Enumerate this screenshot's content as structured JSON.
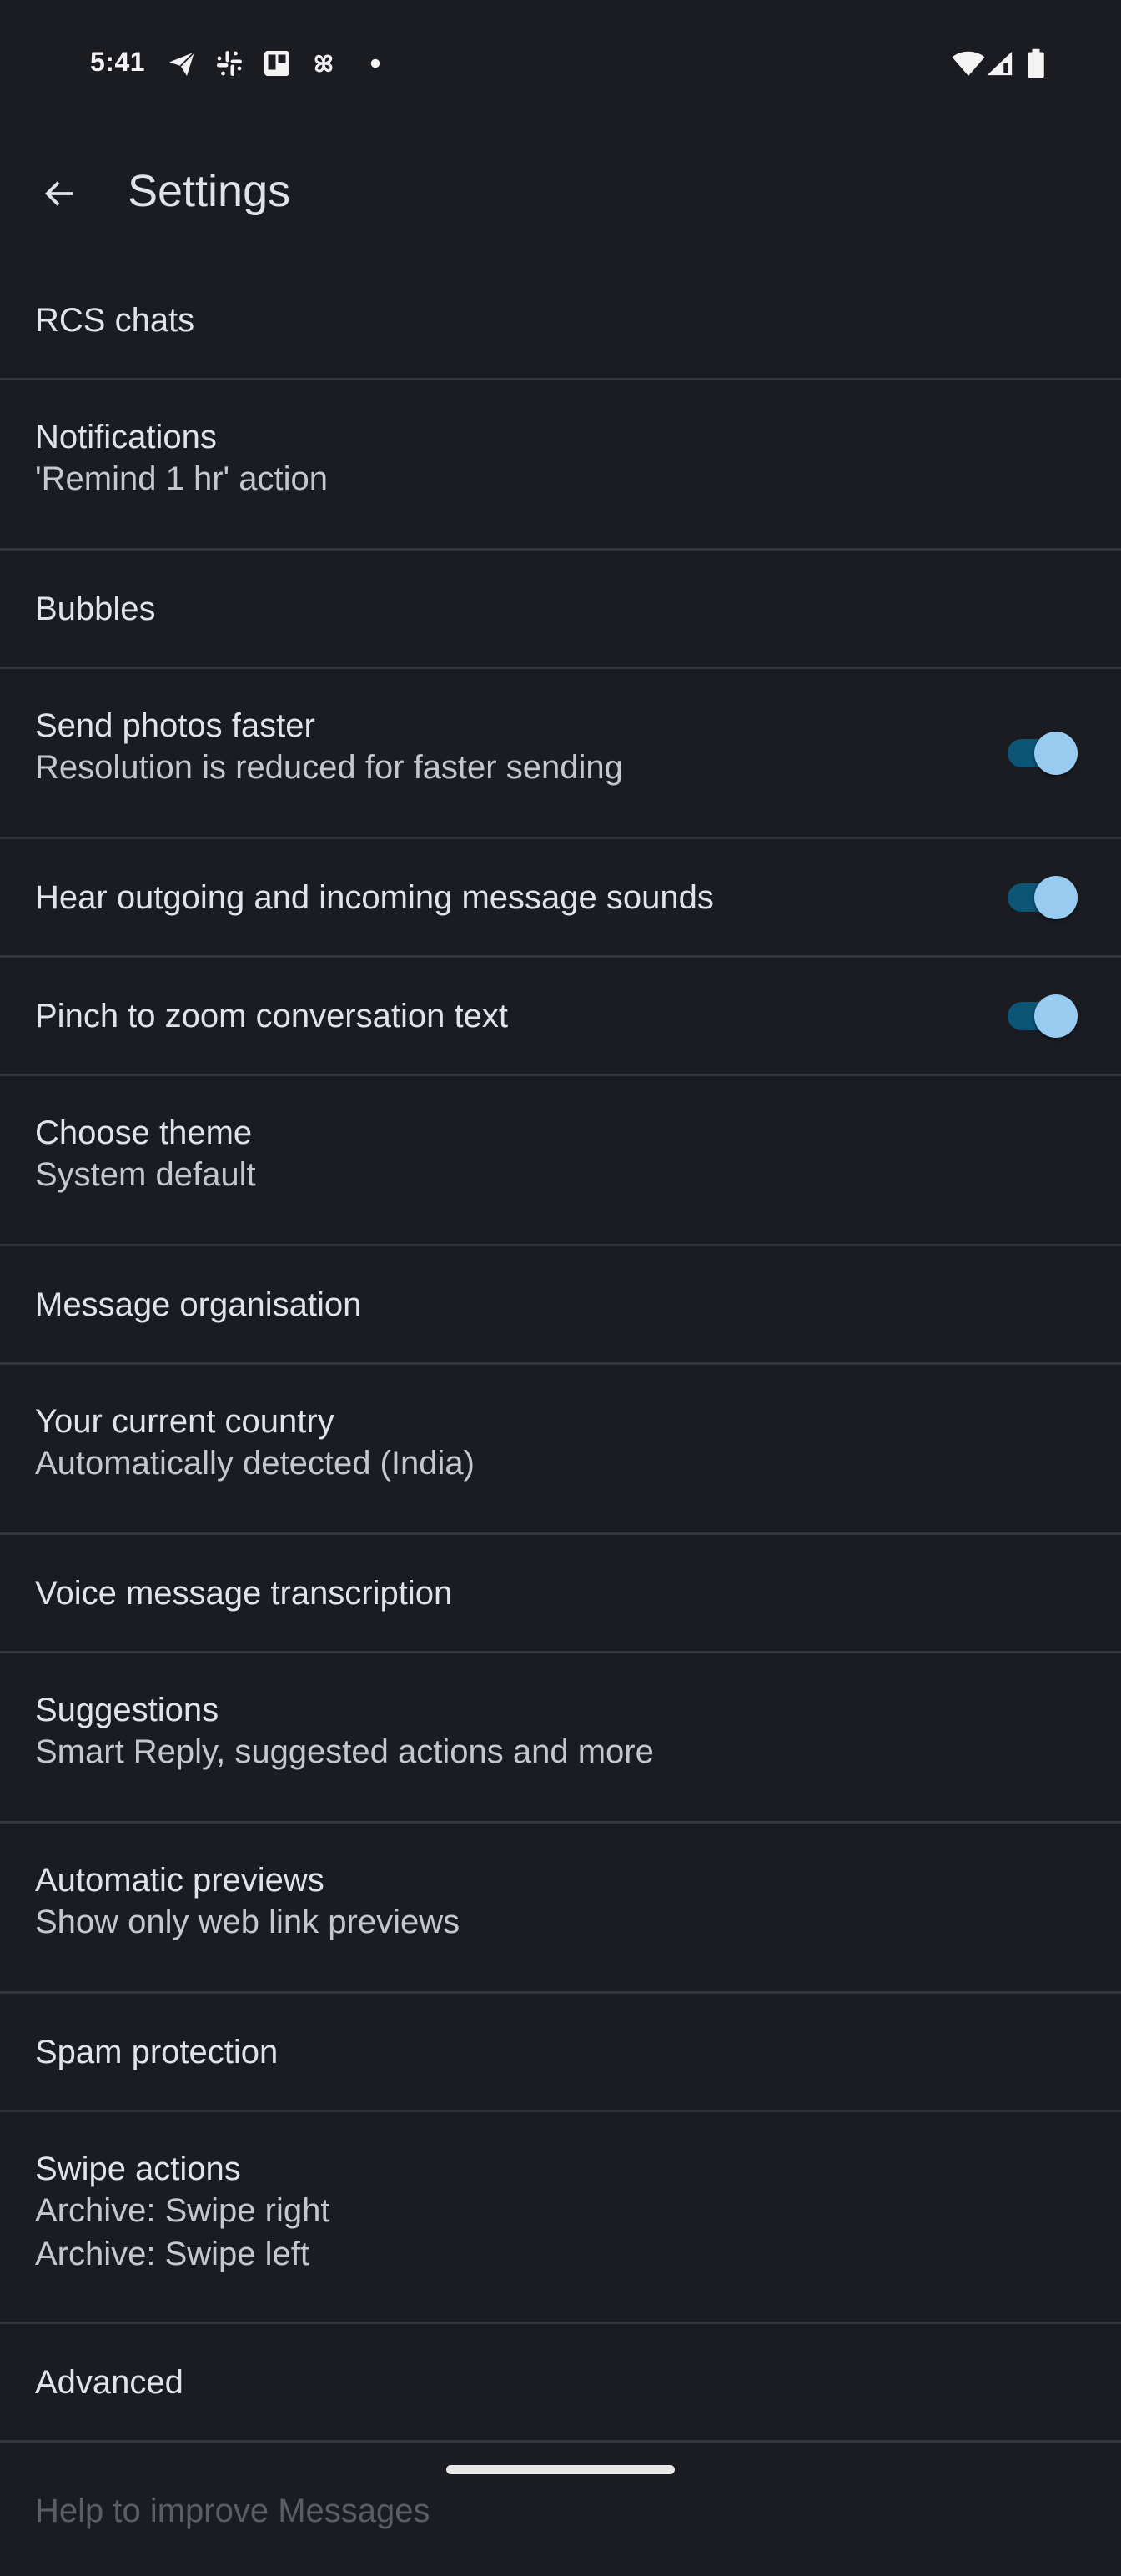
{
  "status_bar": {
    "time": "5:41",
    "notification_icons": [
      "telegram-icon",
      "slack-icon",
      "trello-icon",
      "pinwheel-icon",
      "more-dot-icon"
    ],
    "system_icons": [
      "wifi-icon",
      "cellular-signal-icon",
      "battery-icon"
    ]
  },
  "header": {
    "back_icon": "arrow-back-icon",
    "title": "Settings"
  },
  "settings": [
    {
      "id": "rcs-chats",
      "title": "RCS chats",
      "summary": []
    },
    {
      "id": "notifications",
      "title": "Notifications",
      "summary": [
        "'Remind 1 hr' action"
      ]
    },
    {
      "id": "bubbles",
      "title": "Bubbles",
      "summary": []
    },
    {
      "id": "send-photos-faster",
      "title": "Send photos faster",
      "summary": [
        "Resolution is reduced for faster sending"
      ],
      "toggle": true
    },
    {
      "id": "message-sounds",
      "title": "Hear outgoing and incoming message sounds",
      "summary": [],
      "toggle": true
    },
    {
      "id": "pinch-to-zoom",
      "title": "Pinch to zoom conversation text",
      "summary": [],
      "toggle": true
    },
    {
      "id": "choose-theme",
      "title": "Choose theme",
      "summary": [
        "System default"
      ]
    },
    {
      "id": "message-organisation",
      "title": "Message organisation",
      "summary": []
    },
    {
      "id": "current-country",
      "title": "Your current country",
      "summary": [
        "Automatically detected (India)"
      ]
    },
    {
      "id": "voice-transcription",
      "title": "Voice message transcription",
      "summary": []
    },
    {
      "id": "suggestions",
      "title": "Suggestions",
      "summary": [
        "Smart Reply, suggested actions and more"
      ]
    },
    {
      "id": "automatic-previews",
      "title": "Automatic previews",
      "summary": [
        "Show only web link previews"
      ]
    },
    {
      "id": "spam-protection",
      "title": "Spam protection",
      "summary": []
    },
    {
      "id": "swipe-actions",
      "title": "Swipe actions",
      "summary": [
        "Archive: Swipe right",
        "Archive: Swipe left"
      ]
    },
    {
      "id": "advanced",
      "title": "Advanced",
      "summary": []
    },
    {
      "id": "help-improve",
      "title": "Help to improve Messages",
      "summary": [],
      "partial": true
    }
  ],
  "colors": {
    "background": "#1a1c22",
    "divider": "#33363d",
    "title_text": "#e2e3ea",
    "summary_text": "#c4c7cf",
    "switch_track_on": "#0b5577",
    "switch_thumb_on": "#98cbf0"
  }
}
